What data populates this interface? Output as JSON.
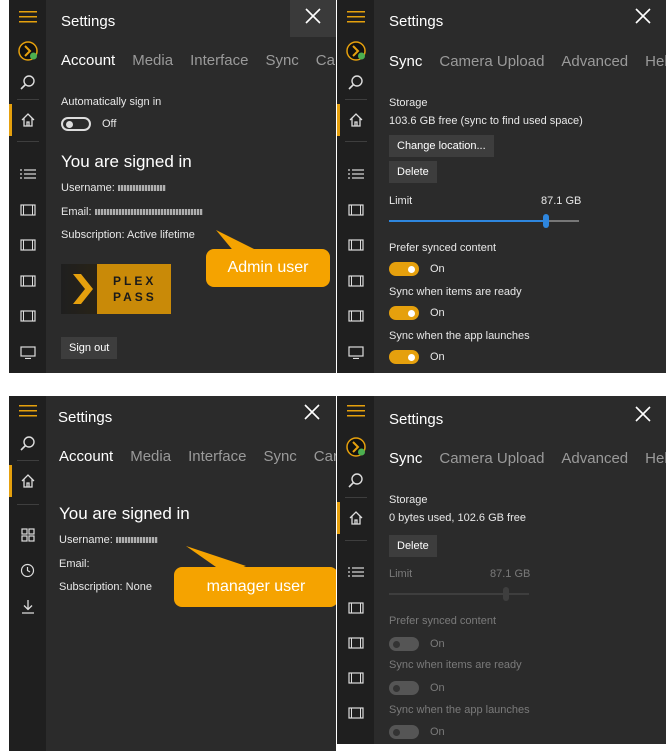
{
  "panel_admin_account": {
    "title": "Settings",
    "tabs": [
      "Account",
      "Media",
      "Interface",
      "Sync",
      "Car"
    ],
    "auto_sign_in_label": "Automatically sign in",
    "auto_sign_in_state": "Off",
    "signed_in_heading": "You are signed in",
    "username_label": "Username:",
    "email_label": "Email:",
    "subscription": "Subscription: Active lifetime",
    "plex_pass_line1": "PLEX",
    "plex_pass_line2": "PASS",
    "sign_out_label": "Sign out",
    "callout": "Admin user"
  },
  "panel_admin_sync": {
    "title": "Settings",
    "tabs": [
      "Sync",
      "Camera Upload",
      "Advanced",
      "Help"
    ],
    "storage_label": "Storage",
    "storage_value": "103.6 GB free (sync to find used space)",
    "change_location_label": "Change location...",
    "delete_label": "Delete",
    "limit_label": "Limit",
    "limit_value": "87.1 GB",
    "limit_fraction": 0.83,
    "prefer_synced_label": "Prefer synced content",
    "prefer_synced_state": "On",
    "sync_items_ready_label": "Sync when items are ready",
    "sync_items_ready_state": "On",
    "sync_app_launch_label": "Sync when the app launches",
    "sync_app_launch_state": "On"
  },
  "panel_manager_account": {
    "title": "Settings",
    "tabs": [
      "Account",
      "Media",
      "Interface",
      "Sync",
      "Car"
    ],
    "signed_in_heading": "You are signed in",
    "username_label": "Username:",
    "email_label": "Email:",
    "subscription": "Subscription: None",
    "callout": "manager user"
  },
  "panel_manager_sync": {
    "title": "Settings",
    "tabs": [
      "Sync",
      "Camera Upload",
      "Advanced",
      "Help"
    ],
    "storage_label": "Storage",
    "storage_value": "0 bytes used, 102.6 GB free",
    "delete_label": "Delete",
    "limit_label": "Limit",
    "limit_value": "87.1 GB",
    "prefer_synced_label": "Prefer synced content",
    "prefer_synced_state": "On",
    "sync_items_ready_label": "Sync when items are ready",
    "sync_items_ready_state": "On",
    "sync_app_launch_label": "Sync when the app launches",
    "sync_app_launch_state": "On"
  },
  "colors": {
    "accent": "#e5a00d",
    "callout": "#f5a300",
    "panel_bg": "#2b2b2b",
    "rail_bg": "#1f1f1f"
  },
  "icons": [
    "hamburger-icon",
    "plex-logo-icon",
    "search-icon",
    "home-icon",
    "list-icon",
    "film-icon",
    "tv-icon",
    "grid-icon",
    "clock-icon",
    "download-icon",
    "close-icon"
  ]
}
